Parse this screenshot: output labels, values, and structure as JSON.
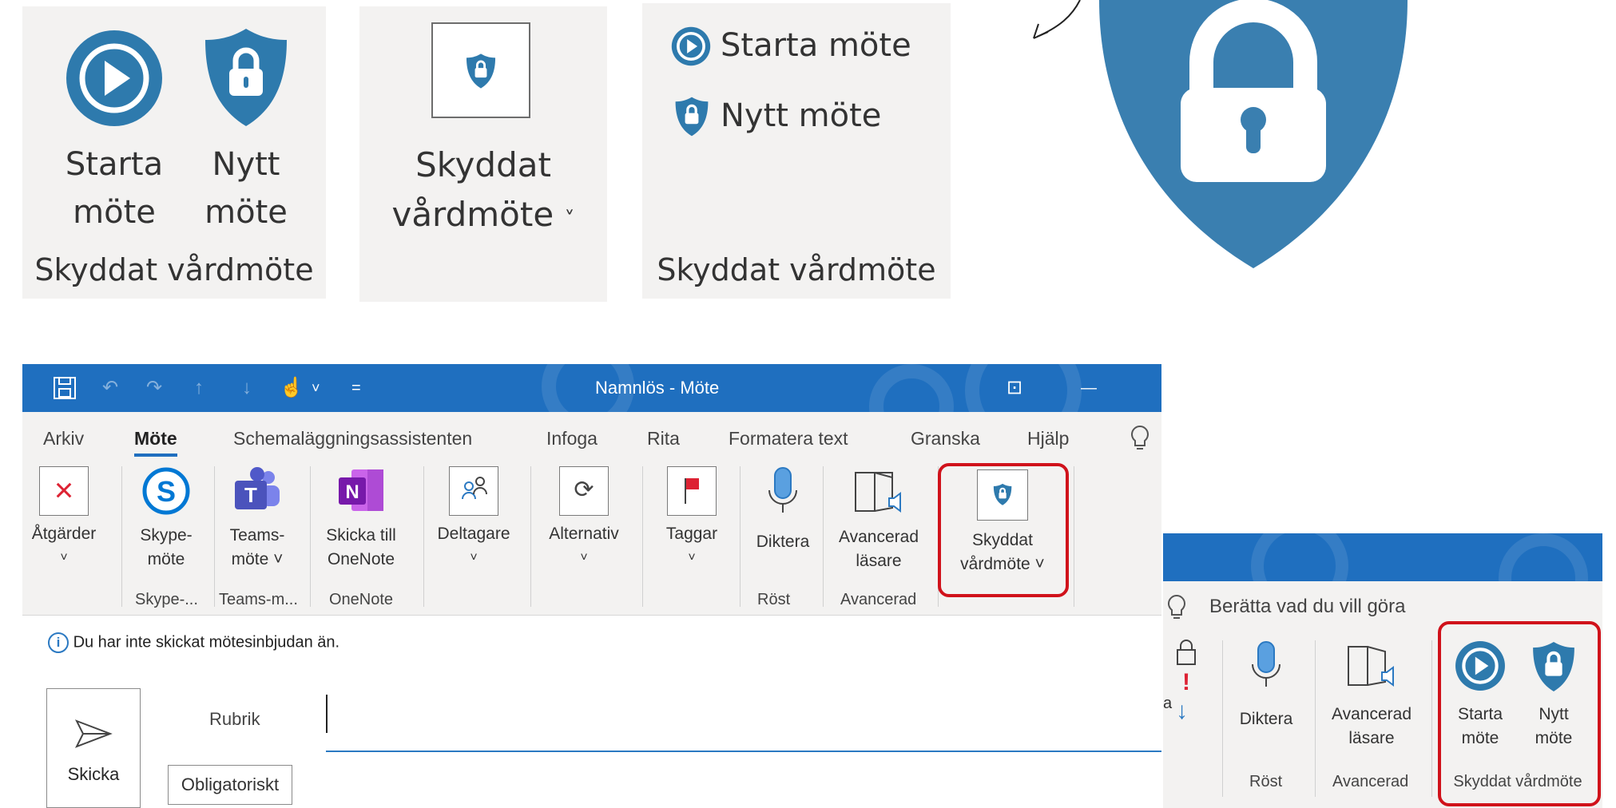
{
  "panel1": {
    "start_label_l1": "Starta",
    "start_label_l2": "möte",
    "new_label_l1": "Nytt",
    "new_label_l2": "möte",
    "group": "Skyddat vårdmöte"
  },
  "panel2": {
    "label_l1": "Skyddat",
    "label_l2": "vårdmöte",
    "chevron": "˅"
  },
  "panel3": {
    "start": "Starta möte",
    "new": "Nytt möte",
    "group": "Skyddat vårdmöte"
  },
  "window": {
    "title": "Namnlös  -  Möte",
    "qat": {
      "undo": "↶",
      "redo": "↷",
      "up": "↑",
      "down": "↓",
      "touch": "☝",
      "more": "˅",
      "customize": "="
    },
    "controls": {
      "display": "⊡",
      "minimize": "—"
    }
  },
  "tabs": [
    "Arkiv",
    "Möte",
    "Schemaläggningsassistenten",
    "Infoga",
    "Rita",
    "Formatera text",
    "Granska",
    "Hjälp"
  ],
  "tell_me_icon": "lightbulb-icon",
  "ribbon": {
    "actions": {
      "label": "Åtgärder",
      "chevron": "˅"
    },
    "skype": {
      "label_l1": "Skype-",
      "label_l2": "möte",
      "group": "Skype-..."
    },
    "teams": {
      "label_l1": "Teams-",
      "label_l2": "möte ˅",
      "group": "Teams-m..."
    },
    "onenote": {
      "label_l1": "Skicka till",
      "label_l2": "OneNote",
      "group": "OneNote"
    },
    "attendees": {
      "label": "Deltagare",
      "chevron": "˅"
    },
    "options": {
      "label": "Alternativ",
      "chevron": "˅"
    },
    "tags": {
      "label": "Taggar",
      "chevron": "˅"
    },
    "dictate": {
      "label": "Diktera",
      "group": "Röst"
    },
    "reader": {
      "label_l1": "Avancerad",
      "label_l2": "läsare",
      "group": "Avancerad"
    },
    "secure": {
      "label_l1": "Skyddat",
      "label_l2": "vårdmöte ˅"
    }
  },
  "infobar": {
    "text": "Du har inte skickat mötesinbjudan än."
  },
  "compose": {
    "send": "Skicka",
    "subject_label": "Rubrik",
    "required": "Obligatoriskt"
  },
  "inset": {
    "tell_me": "Berätta vad du vill göra",
    "partial_letter": "a",
    "dictate": "Diktera",
    "reader_l1": "Avancerad",
    "reader_l2": "läsare",
    "start_l1": "Starta",
    "start_l2": "möte",
    "new_l1": "Nytt",
    "new_l2": "möte",
    "group_voice": "Röst",
    "group_adv": "Avancerad",
    "group_secure": "Skyddat vårdmöte"
  },
  "colors": {
    "brand_blue": "#1f6fbf",
    "icon_blue": "#2e7aad",
    "highlight_red": "#d0121b",
    "ribbon_bg": "#f3f2f1"
  }
}
